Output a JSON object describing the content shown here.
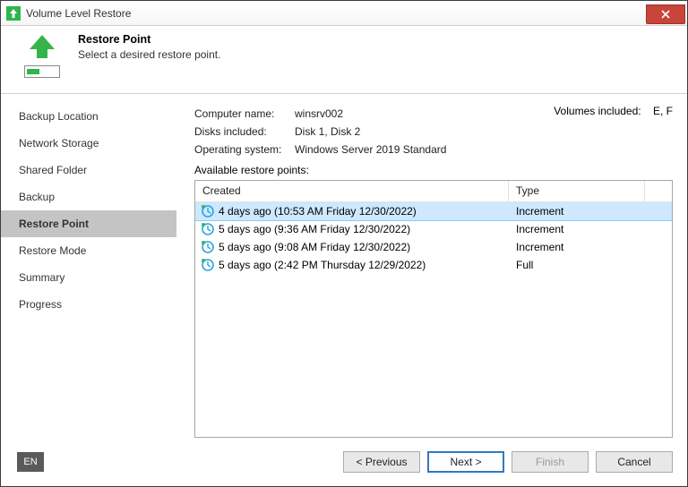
{
  "window": {
    "title": "Volume Level Restore"
  },
  "header": {
    "title": "Restore Point",
    "subtitle": "Select a desired restore point."
  },
  "sidebar": {
    "items": [
      {
        "label": "Backup Location",
        "active": false
      },
      {
        "label": "Network Storage",
        "active": false
      },
      {
        "label": "Shared Folder",
        "active": false
      },
      {
        "label": "Backup",
        "active": false
      },
      {
        "label": "Restore Point",
        "active": true
      },
      {
        "label": "Restore Mode",
        "active": false
      },
      {
        "label": "Summary",
        "active": false
      },
      {
        "label": "Progress",
        "active": false
      }
    ]
  },
  "details": {
    "computer_name_label": "Computer name:",
    "computer_name": "winsrv002",
    "volumes_included_label": "Volumes included:",
    "volumes_included": "E, F",
    "disks_included_label": "Disks included:",
    "disks_included": "Disk 1, Disk 2",
    "os_label": "Operating system:",
    "os": "Windows Server 2019 Standard",
    "available_label": "Available restore points:"
  },
  "table": {
    "columns": {
      "created": "Created",
      "type": "Type"
    },
    "rows": [
      {
        "created": "4 days ago (10:53 AM Friday 12/30/2022)",
        "type": "Increment",
        "selected": true
      },
      {
        "created": "5 days ago (9:36 AM Friday 12/30/2022)",
        "type": "Increment",
        "selected": false
      },
      {
        "created": "5 days ago (9:08 AM Friday 12/30/2022)",
        "type": "Increment",
        "selected": false
      },
      {
        "created": "5 days ago (2:42 PM Thursday 12/29/2022)",
        "type": "Full",
        "selected": false
      }
    ]
  },
  "footer": {
    "lang": "EN",
    "previous": "< Previous",
    "next": "Next >",
    "finish": "Finish",
    "cancel": "Cancel"
  }
}
